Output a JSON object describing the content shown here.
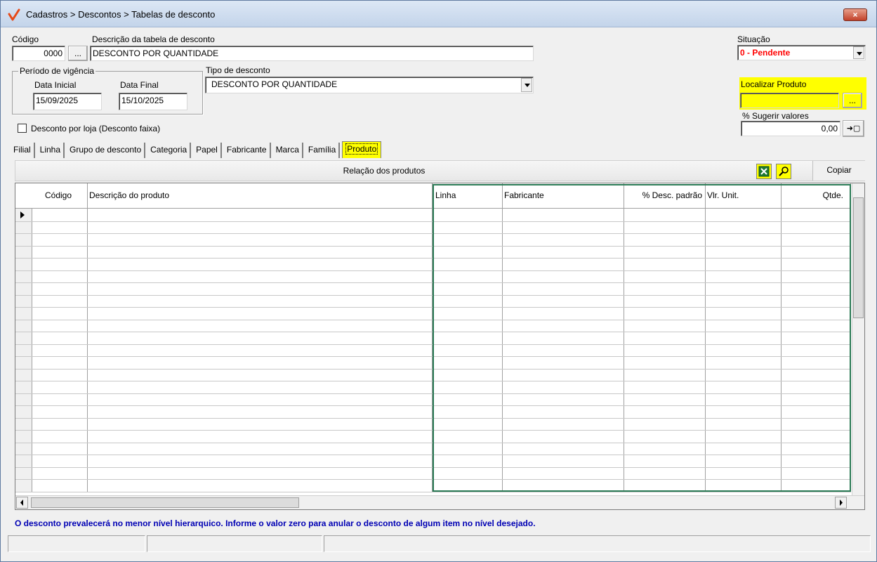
{
  "window": {
    "title": "Cadastros > Descontos > Tabelas de desconto",
    "close_label": "×"
  },
  "form": {
    "codigo_label": "Código",
    "codigo_value": "0000",
    "codigo_lookup_label": "...",
    "descricao_label": "Descrição da tabela de desconto",
    "descricao_value": "DESCONTO POR QUANTIDADE",
    "situacao_label": "Situação",
    "situacao_value": "0 - Pendente",
    "periodo_label": "Período de vigência",
    "data_inicial_label": "Data Inicial",
    "data_inicial_value": "15/09/2025",
    "data_final_label": "Data Final",
    "data_final_value": "15/10/2025",
    "tipo_label": "Tipo de desconto",
    "tipo_value": "DESCONTO POR QUANTIDADE",
    "localizar_label": "Localizar Produto",
    "localizar_value": "",
    "localizar_lookup_label": "...",
    "sugerir_label": "% Sugerir valores",
    "sugerir_value": "0,00",
    "sugerir_apply_label": "➜▢",
    "desconto_loja_label": "Desconto por loja (Desconto faixa)"
  },
  "tabs": [
    {
      "label": "Filial"
    },
    {
      "label": "Linha"
    },
    {
      "label": "Grupo de desconto"
    },
    {
      "label": "Categoria"
    },
    {
      "label": "Papel"
    },
    {
      "label": "Fabricante"
    },
    {
      "label": "Marca"
    },
    {
      "label": "Família"
    },
    {
      "label": "Produto"
    }
  ],
  "active_tab": "Produto",
  "products": {
    "title": "Relação dos produtos",
    "copy_label": "Copiar",
    "excel_icon": "excel-icon",
    "search_icon": "search-icon",
    "columns": [
      {
        "label": "Código"
      },
      {
        "label": "Descrição do produto"
      },
      {
        "label": "Linha"
      },
      {
        "label": "Fabricante"
      },
      {
        "label": "% Desc. padrão"
      },
      {
        "label": "Vlr. Unit."
      },
      {
        "label": "Qtde."
      }
    ]
  },
  "info_message": "O desconto prevalecerá no menor nível hierarquico. Informe o valor zero para anular o desconto de algum item no nível desejado.",
  "colors": {
    "accent_yellow": "#ffff00",
    "situacao_red": "#ff0000",
    "info_blue": "#0000b4",
    "highlight_green": "#2a7a55"
  }
}
